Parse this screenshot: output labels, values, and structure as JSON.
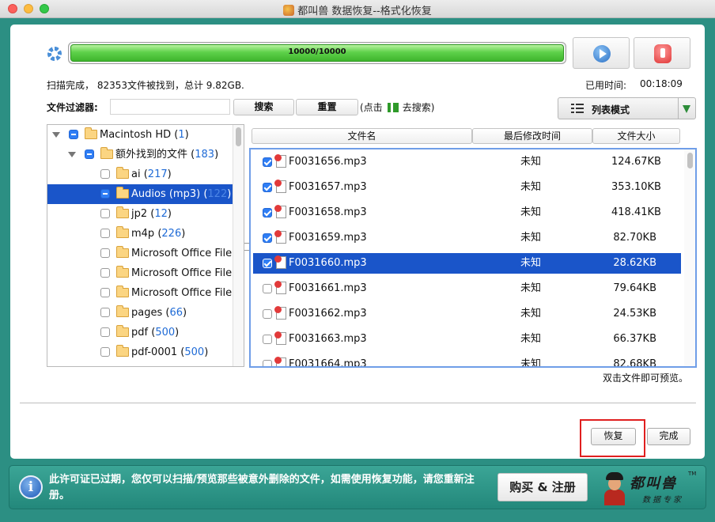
{
  "window": {
    "title": "都叫兽 数据恢复--格式化恢复"
  },
  "scan": {
    "progress_text": "10000/10000",
    "progress_fraction": 1.0,
    "status": "扫描完成， 82353文件被找到，总计 9.82GB.",
    "elapsed_label": "已用时间:",
    "elapsed_value": "00:18:09"
  },
  "filter": {
    "label": "文件过滤器:",
    "value": "",
    "search_label": "搜索",
    "reset_label": "重置",
    "hint_prefix": "(点击",
    "hint_suffix": "去搜索)"
  },
  "view_mode": {
    "label": "列表模式"
  },
  "tree": [
    {
      "name": "Macintosh HD",
      "count": "1",
      "state": "mixed",
      "level": 0,
      "expanded": true
    },
    {
      "name": "额外找到的文件",
      "count": "183",
      "state": "mixed",
      "level": 1,
      "expanded": true
    },
    {
      "name": "ai",
      "count": "217",
      "state": "none",
      "level": 2
    },
    {
      "name": "Audios (mp3)",
      "count": "122",
      "state": "mixed",
      "level": 2,
      "selected": true
    },
    {
      "name": "jp2",
      "count": "12",
      "state": "none",
      "level": 2
    },
    {
      "name": "m4p",
      "count": "226",
      "state": "none",
      "level": 2
    },
    {
      "name": "Microsoft Office File",
      "count": "",
      "state": "none",
      "level": 2
    },
    {
      "name": "Microsoft Office File",
      "count": "",
      "state": "none",
      "level": 2
    },
    {
      "name": "Microsoft Office File",
      "count": "",
      "state": "none",
      "level": 2
    },
    {
      "name": "pages",
      "count": "66",
      "state": "none",
      "level": 2
    },
    {
      "name": "pdf",
      "count": "500",
      "state": "none",
      "level": 2
    },
    {
      "name": "pdf-0001",
      "count": "500",
      "state": "none",
      "level": 2
    }
  ],
  "columns": {
    "name": "文件名",
    "date": "最后修改时间",
    "size": "文件大小"
  },
  "files": [
    {
      "name": "F0031656.mp3",
      "date": "未知",
      "size": "124.67KB",
      "checked": true
    },
    {
      "name": "F0031657.mp3",
      "date": "未知",
      "size": "353.10KB",
      "checked": true
    },
    {
      "name": "F0031658.mp3",
      "date": "未知",
      "size": "418.41KB",
      "checked": true
    },
    {
      "name": "F0031659.mp3",
      "date": "未知",
      "size": "82.70KB",
      "checked": true
    },
    {
      "name": "F0031660.mp3",
      "date": "未知",
      "size": "28.62KB",
      "checked": true,
      "selected": true
    },
    {
      "name": "F0031661.mp3",
      "date": "未知",
      "size": "79.64KB",
      "checked": false
    },
    {
      "name": "F0031662.mp3",
      "date": "未知",
      "size": "24.53KB",
      "checked": false
    },
    {
      "name": "F0031663.mp3",
      "date": "未知",
      "size": "66.37KB",
      "checked": false
    },
    {
      "name": "F0031664.mp3",
      "date": "未知",
      "size": "82.68KB",
      "checked": false
    }
  ],
  "preview_hint": "双击文件即可预览。",
  "actions": {
    "recover_label": "恢复",
    "finish_label": "完成"
  },
  "banner": {
    "message": "此许可证已过期，您仅可以扫描/预览那些被意外删除的文件，如需使用恢复功能，请您重新注册。",
    "buy_label": "购买 & 注册",
    "logo_name": "都叫兽",
    "logo_tm": "TM",
    "logo_sub": "数据专家"
  },
  "colors": {
    "selection": "#1a55c9",
    "progress": "#5ed14a",
    "banner": "#2c8f83",
    "highlight_box": "#e01f1f"
  }
}
